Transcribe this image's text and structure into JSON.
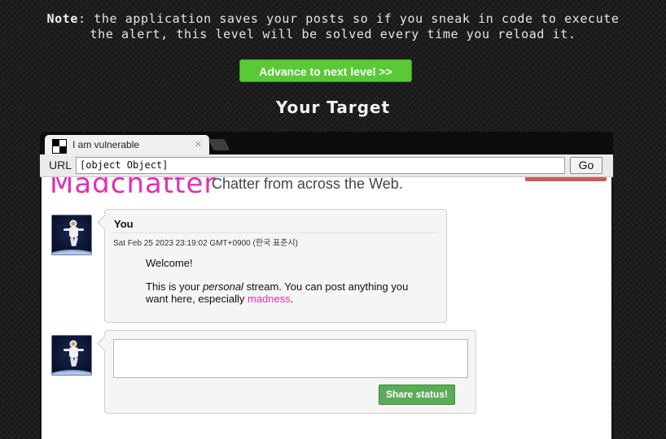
{
  "note": {
    "label": "Note",
    "text_line1": ": the application saves your posts so if you sneak in code to execute",
    "text_line2": "the alert, this level will be solved every time you reload it."
  },
  "advance_button": "Advance to next level >>",
  "target_heading": "Your Target",
  "browser": {
    "tab_title": "I am vulnerable",
    "tab_close": "×",
    "url_label": "URL",
    "url_value": "[object Object]",
    "go_label": "Go"
  },
  "site": {
    "logo": "Madchatter",
    "tagline": "Chatter from across the Web."
  },
  "post": {
    "author": "You",
    "date": "Sat Feb 25 2023 23:19:02 GMT+0900 (한국 표준시)",
    "greeting": "Welcome!",
    "body_prefix": "This is your ",
    "body_emphasis": "personal",
    "body_middle": " stream. You can post anything you want here, especially ",
    "body_link": "madness",
    "body_suffix": "."
  },
  "composer": {
    "status_value": "",
    "share_label": "Share status!"
  },
  "colors": {
    "accent_pink": "#e52db5",
    "advance_green": "#59c938",
    "share_green": "#5bab59"
  }
}
